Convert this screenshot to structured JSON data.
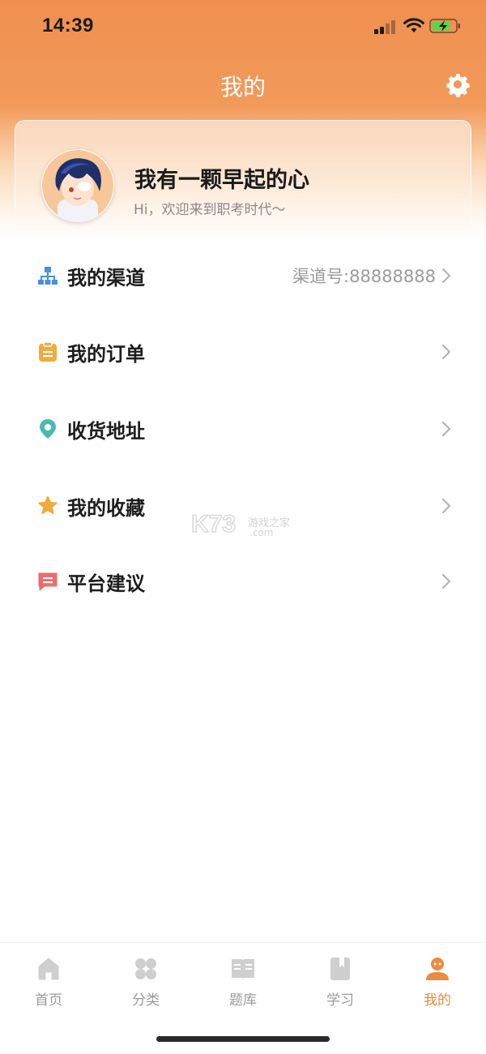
{
  "status_bar": {
    "time": "14:39"
  },
  "header": {
    "title": "我的",
    "settings_icon": "gear-icon"
  },
  "profile": {
    "username": "我有一颗早起的心",
    "welcome": "Hi，欢迎来到职考时代～"
  },
  "menu": [
    {
      "label": "我的渠道",
      "icon": "channel-network-icon",
      "color": "#4a8fe0",
      "value": "渠道号:88888888"
    },
    {
      "label": "我的订单",
      "icon": "clipboard-icon",
      "color": "#f1aa3f",
      "value": ""
    },
    {
      "label": "收货地址",
      "icon": "location-pin-icon",
      "color": "#4cb9b0",
      "value": ""
    },
    {
      "label": "我的收藏",
      "icon": "star-icon",
      "color": "#f1aa3f",
      "value": ""
    },
    {
      "label": "平台建议",
      "icon": "message-icon",
      "color": "#ee6b6b",
      "value": ""
    }
  ],
  "watermark": {
    "brand": "K73",
    "cn": "游戏之家",
    "domain": ".com"
  },
  "tabs": [
    {
      "label": "首页",
      "icon": "home-icon"
    },
    {
      "label": "分类",
      "icon": "category-icon"
    },
    {
      "label": "题库",
      "icon": "question-bank-icon"
    },
    {
      "label": "学习",
      "icon": "study-book-icon"
    },
    {
      "label": "我的",
      "icon": "profile-icon",
      "active": true
    }
  ],
  "colors": {
    "accent": "#ec8a3e",
    "header_gradient_top": "#ee8f4f"
  }
}
